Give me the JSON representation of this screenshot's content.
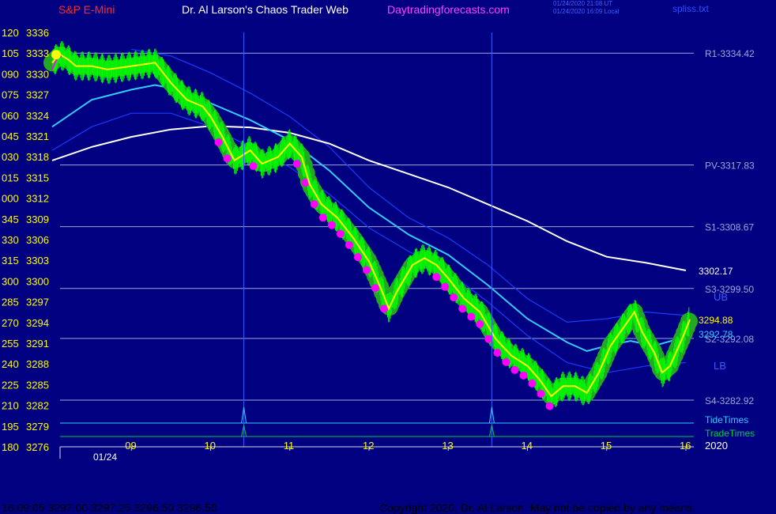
{
  "header": {
    "symbol": "S&P E-Mini",
    "title": "Dr. Al Larson's Chaos Trader Web",
    "site": "Daytradingforecasts.com",
    "utc_time": "01/24/2020 21:08 UT",
    "local_time": "01/24/2020 16:09 Local",
    "file": "spliss.txt"
  },
  "footer": {
    "quote": "16:09:05  3297.00 3297.25 3296.50 3296.50",
    "copyright": "Copyright 2020, Dr. Al Larson. May not be copied by any means."
  },
  "colors": {
    "background": "#000080",
    "price_line": "#ffff00",
    "bars": "#00ff00",
    "glow": "#22a822",
    "fast_line": "#ff00ff",
    "ema_cyan": "#33ccff",
    "ema_white": "#ffffff",
    "bands": "#1a3cff",
    "levels": "#9aa9d9",
    "axis_text": "#ffff00",
    "tide": "#33ccff",
    "trade": "#00cc44"
  },
  "chart_data": {
    "type": "line",
    "title": "S&P E-Mini",
    "date_label": "01/24",
    "year_label": "2020",
    "x_unit": "hour",
    "xlim": [
      8.1,
      16.1
    ],
    "ylim": [
      3276,
      3337.5
    ],
    "time_ticks": [
      "09",
      "10",
      "11",
      "12",
      "13",
      "14",
      "15",
      "16"
    ],
    "y_ticks": [
      {
        "angle": "120",
        "price": "3336"
      },
      {
        "angle": "105",
        "price": "3333"
      },
      {
        "angle": "090",
        "price": "3330"
      },
      {
        "angle": "075",
        "price": "3327"
      },
      {
        "angle": "060",
        "price": "3324"
      },
      {
        "angle": "045",
        "price": "3321"
      },
      {
        "angle": "030",
        "price": "3318"
      },
      {
        "angle": "015",
        "price": "3315"
      },
      {
        "angle": "000",
        "price": "3312"
      },
      {
        "angle": "345",
        "price": "3309"
      },
      {
        "angle": "330",
        "price": "3306"
      },
      {
        "angle": "315",
        "price": "3303"
      },
      {
        "angle": "300",
        "price": "3300"
      },
      {
        "angle": "285",
        "price": "3297"
      },
      {
        "angle": "270",
        "price": "3294"
      },
      {
        "angle": "255",
        "price": "3291"
      },
      {
        "angle": "240",
        "price": "3288"
      },
      {
        "angle": "225",
        "price": "3285"
      },
      {
        "angle": "210",
        "price": "3282"
      },
      {
        "angle": "195",
        "price": "3279"
      },
      {
        "angle": "180",
        "price": "3276"
      }
    ],
    "levels": [
      {
        "label": "R1-3334.42",
        "value": 3334.42
      },
      {
        "label": "PV-3317.83",
        "value": 3317.83
      },
      {
        "label": "S1-3308.67",
        "value": 3308.67
      },
      {
        "label": "S3-3299.50",
        "value": 3299.5
      },
      {
        "label": "S2-3292.08",
        "value": 3292.08
      },
      {
        "label": "S4-3282.92",
        "value": 3282.92
      }
    ],
    "value_labels": [
      {
        "label": "3302.17",
        "value": 3302.17,
        "series": "white_ema"
      },
      {
        "label": "3294.88",
        "value": 3294.88,
        "series": "price"
      },
      {
        "label": "3292.78",
        "value": 3292.78,
        "series": "cyan_ema"
      }
    ],
    "band_labels": [
      "UB",
      "LB"
    ],
    "timing_lines": [
      "TideTimes",
      "TradeTimes"
    ],
    "timing_markers": [
      10.42,
      13.55
    ],
    "series": [
      {
        "id": "price",
        "values": [
          [
            8.0,
            3333
          ],
          [
            8.1,
            3334.2
          ],
          [
            8.2,
            3333.5
          ],
          [
            8.3,
            3332.5
          ],
          [
            8.5,
            3332.5
          ],
          [
            8.7,
            3332
          ],
          [
            9.0,
            3332.5
          ],
          [
            9.3,
            3333
          ],
          [
            9.5,
            3330
          ],
          [
            9.7,
            3327.5
          ],
          [
            9.9,
            3326.5
          ],
          [
            10.0,
            3325
          ],
          [
            10.15,
            3322
          ],
          [
            10.3,
            3318.5
          ],
          [
            10.5,
            3320
          ],
          [
            10.65,
            3318
          ],
          [
            10.85,
            3319
          ],
          [
            11.0,
            3321
          ],
          [
            11.15,
            3319
          ],
          [
            11.25,
            3315
          ],
          [
            11.4,
            3312
          ],
          [
            11.6,
            3310
          ],
          [
            11.8,
            3307
          ],
          [
            12.0,
            3303.5
          ],
          [
            12.15,
            3299.5
          ],
          [
            12.25,
            3296.5
          ],
          [
            12.35,
            3299
          ],
          [
            12.55,
            3303
          ],
          [
            12.7,
            3304
          ],
          [
            12.85,
            3303
          ],
          [
            13.0,
            3301
          ],
          [
            13.2,
            3298
          ],
          [
            13.4,
            3296
          ],
          [
            13.6,
            3292
          ],
          [
            13.8,
            3289.5
          ],
          [
            14.0,
            3288
          ],
          [
            14.15,
            3286
          ],
          [
            14.3,
            3283.5
          ],
          [
            14.45,
            3285
          ],
          [
            14.6,
            3285
          ],
          [
            14.75,
            3284
          ],
          [
            14.9,
            3287
          ],
          [
            15.05,
            3291
          ],
          [
            15.2,
            3293.5
          ],
          [
            15.35,
            3296
          ],
          [
            15.45,
            3293
          ],
          [
            15.6,
            3290
          ],
          [
            15.7,
            3287
          ],
          [
            15.8,
            3288
          ],
          [
            15.95,
            3292
          ],
          [
            16.05,
            3294.9
          ]
        ]
      },
      {
        "id": "fast_ma",
        "values": [
          [
            8.0,
            3332
          ],
          [
            8.06,
            3333.6
          ],
          [
            8.12,
            3334.0
          ]
        ]
      },
      {
        "id": "cyan_ema",
        "values": [
          [
            8.0,
            3323.5
          ],
          [
            8.5,
            3327.5
          ],
          [
            9.0,
            3329
          ],
          [
            9.3,
            3329.7
          ],
          [
            9.6,
            3329
          ],
          [
            10.0,
            3327
          ],
          [
            10.5,
            3324.5
          ],
          [
            11.0,
            3321.5
          ],
          [
            11.5,
            3317
          ],
          [
            12.0,
            3311.5
          ],
          [
            12.5,
            3307.5
          ],
          [
            13.0,
            3304.5
          ],
          [
            13.5,
            3300
          ],
          [
            14.0,
            3295
          ],
          [
            14.5,
            3291.5
          ],
          [
            14.75,
            3290.2
          ],
          [
            15.0,
            3291
          ],
          [
            15.3,
            3291.7
          ],
          [
            15.6,
            3291
          ],
          [
            15.9,
            3292
          ],
          [
            16.05,
            3292.8
          ]
        ]
      },
      {
        "id": "white_ema",
        "values": [
          [
            8.0,
            3318.5
          ],
          [
            8.5,
            3320.5
          ],
          [
            9.0,
            3322
          ],
          [
            9.5,
            3323.1
          ],
          [
            10.0,
            3323.6
          ],
          [
            10.5,
            3323.4
          ],
          [
            11.0,
            3322.6
          ],
          [
            11.5,
            3321
          ],
          [
            12.0,
            3318.5
          ],
          [
            12.5,
            3316.5
          ],
          [
            13.0,
            3314.5
          ],
          [
            13.5,
            3312
          ],
          [
            14.0,
            3309.5
          ],
          [
            14.5,
            3306.5
          ],
          [
            15.0,
            3304.2
          ],
          [
            15.5,
            3303.3
          ],
          [
            16.0,
            3302.17
          ]
        ]
      },
      {
        "id": "upper_band",
        "values": [
          [
            9.0,
            3335
          ],
          [
            9.5,
            3334
          ],
          [
            10.0,
            3331.5
          ],
          [
            10.5,
            3328.5
          ],
          [
            11.0,
            3325
          ],
          [
            11.5,
            3320.5
          ],
          [
            12.0,
            3314.5
          ],
          [
            12.5,
            3310
          ],
          [
            13.0,
            3307
          ],
          [
            13.5,
            3303
          ],
          [
            14.0,
            3298
          ],
          [
            14.5,
            3294.5
          ],
          [
            15.0,
            3295
          ],
          [
            15.5,
            3296
          ],
          [
            16.0,
            3295.5
          ]
        ]
      },
      {
        "id": "lower_band",
        "values": [
          [
            8.0,
            3320
          ],
          [
            8.5,
            3323.5
          ],
          [
            9.0,
            3325.5
          ],
          [
            9.5,
            3325.5
          ],
          [
            10.0,
            3323.5
          ],
          [
            10.5,
            3320.5
          ],
          [
            11.0,
            3317.5
          ],
          [
            11.5,
            3313.5
          ],
          [
            12.0,
            3308.5
          ],
          [
            12.5,
            3305
          ],
          [
            13.0,
            3302
          ],
          [
            13.5,
            3297.5
          ],
          [
            14.0,
            3292.5
          ],
          [
            14.5,
            3288.5
          ],
          [
            15.0,
            3287
          ],
          [
            15.5,
            3288
          ],
          [
            16.0,
            3288.5
          ]
        ]
      }
    ]
  }
}
